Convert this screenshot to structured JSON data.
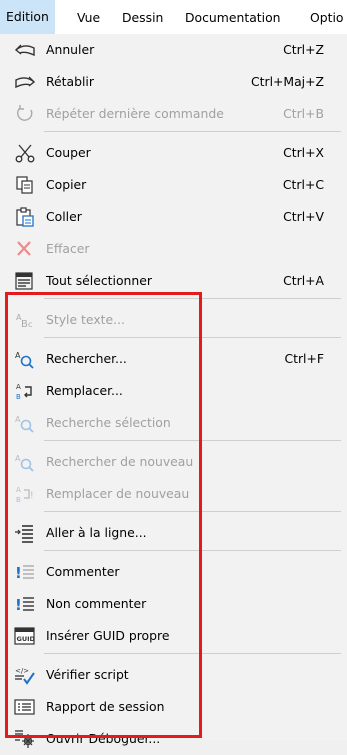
{
  "menubar": {
    "items": [
      "Edition",
      "Vue",
      "Dessin",
      "Documentation",
      "Optio"
    ]
  },
  "menu": {
    "items": [
      {
        "label": "Annuler",
        "shortcut": "Ctrl+Z",
        "icon": "undo-icon"
      },
      {
        "label": "Rétablir",
        "shortcut": "Ctrl+Maj+Z",
        "icon": "redo-icon"
      },
      {
        "label": "Répéter dernière commande",
        "shortcut": "Ctrl+B",
        "icon": "repeat-icon"
      },
      {
        "label": "Couper",
        "shortcut": "Ctrl+X",
        "icon": "cut-icon"
      },
      {
        "label": "Copier",
        "shortcut": "Ctrl+C",
        "icon": "copy-icon"
      },
      {
        "label": "Coller",
        "shortcut": "Ctrl+V",
        "icon": "paste-icon"
      },
      {
        "label": "Effacer",
        "shortcut": "",
        "icon": "delete-icon"
      },
      {
        "label": "Tout sélectionner",
        "shortcut": "Ctrl+A",
        "icon": "select-all-icon"
      },
      {
        "label": "Style texte...",
        "shortcut": "",
        "icon": "text-style-icon"
      },
      {
        "label": "Rechercher...",
        "shortcut": "Ctrl+F",
        "icon": "search-icon"
      },
      {
        "label": "Remplacer...",
        "shortcut": "",
        "icon": "replace-icon"
      },
      {
        "label": "Recherche sélection",
        "shortcut": "",
        "icon": "search-selection-icon"
      },
      {
        "label": "Rechercher de nouveau",
        "shortcut": "",
        "icon": "search-again-icon"
      },
      {
        "label": "Remplacer de nouveau",
        "shortcut": "",
        "icon": "replace-again-icon"
      },
      {
        "label": "Aller à la ligne...",
        "shortcut": "",
        "icon": "goto-line-icon"
      },
      {
        "label": "Commenter",
        "shortcut": "",
        "icon": "comment-icon"
      },
      {
        "label": "Non commenter",
        "shortcut": "",
        "icon": "uncomment-icon"
      },
      {
        "label": "Insérer GUID propre",
        "shortcut": "",
        "icon": "guid-icon"
      },
      {
        "label": "Vérifier script",
        "shortcut": "",
        "icon": "check-script-icon"
      },
      {
        "label": "Rapport de session",
        "shortcut": "",
        "icon": "session-report-icon"
      },
      {
        "label": "Ouvrir Déboguer...",
        "shortcut": "",
        "icon": "debugger-icon"
      }
    ]
  },
  "colors": {
    "highlight_box": "#e41b1b",
    "menu_bg": "#f2f2f2",
    "disabled_text": "#a0a0a0",
    "icon_blue": "#1e73c8"
  }
}
